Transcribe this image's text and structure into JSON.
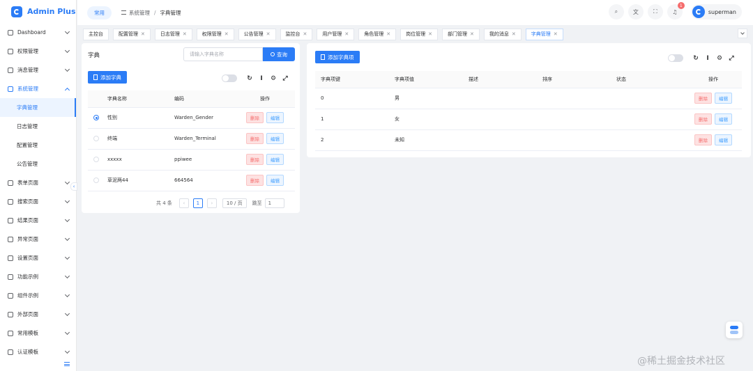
{
  "app": {
    "title": "Admin Plus"
  },
  "sidebar": {
    "items": [
      {
        "label": "Dashboard"
      },
      {
        "label": "权限管理"
      },
      {
        "label": "消息管理"
      },
      {
        "label": "系统管理",
        "children": [
          "字典管理",
          "日志管理",
          "配置管理",
          "公告管理"
        ]
      },
      {
        "label": "表单页面"
      },
      {
        "label": "搜索页面"
      },
      {
        "label": "结果页面"
      },
      {
        "label": "异常页面"
      },
      {
        "label": "设置页面"
      },
      {
        "label": "功能示例"
      },
      {
        "label": "组件示例"
      },
      {
        "label": "外部页面"
      },
      {
        "label": "常用模板"
      },
      {
        "label": "认证模板"
      }
    ]
  },
  "header": {
    "common_tag": "常用",
    "breadcrumb": [
      "系统管理",
      "字典管理"
    ],
    "notification_count": "1",
    "username": "superman"
  },
  "tabs": [
    "主控台",
    "配置管理",
    "日志管理",
    "权限管理",
    "公告管理",
    "监控台",
    "用户管理",
    "角色管理",
    "岗位管理",
    "部门管理",
    "我的消息",
    "字典管理"
  ],
  "dict_panel": {
    "title": "字典",
    "search_placeholder": "请输入字典名称",
    "search_button": "查询",
    "add_button": "添加字典",
    "columns": [
      "字典名称",
      "编码",
      "操作"
    ],
    "rows": [
      {
        "name": "性别",
        "code": "Warden_Gender",
        "selected": true
      },
      {
        "name": "终端",
        "code": "Warden_Terminal",
        "selected": false
      },
      {
        "name": "xxxxx",
        "code": "ppiwee",
        "selected": false
      },
      {
        "name": "草泥两44",
        "code": "664564",
        "selected": false
      }
    ],
    "delete_label": "删除",
    "edit_label": "编辑",
    "pagination": {
      "total": "共 4 条",
      "current_page": "1",
      "page_size": "10 / 页",
      "jump_label": "跳至",
      "jump_value": "1"
    }
  },
  "item_panel": {
    "add_button": "添加字典项",
    "columns": [
      "字典项键",
      "字典项值",
      "描述",
      "排序",
      "状态",
      "操作"
    ],
    "rows": [
      {
        "key": "0",
        "value": "男"
      },
      {
        "key": "1",
        "value": "女"
      },
      {
        "key": "2",
        "value": "未知"
      }
    ],
    "delete_label": "删除",
    "edit_label": "编辑"
  },
  "watermark": "@稀土掘金技术社区",
  "colors": {
    "primary": "#2b7cf6",
    "danger": "#f56c6c"
  }
}
